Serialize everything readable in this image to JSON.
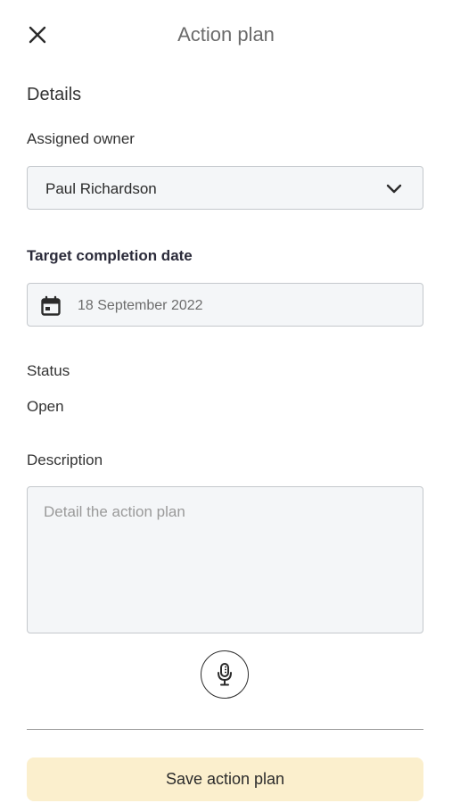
{
  "header": {
    "title": "Action plan",
    "close_icon": "close-icon"
  },
  "details": {
    "heading": "Details"
  },
  "owner": {
    "label": "Assigned owner",
    "value": "Paul Richardson",
    "icon": "chevron-down-icon"
  },
  "target_date": {
    "label": "Target completion date",
    "value": "18 September 2022",
    "icon": "calendar-icon"
  },
  "status": {
    "label": "Status",
    "value": "Open"
  },
  "description": {
    "label": "Description",
    "placeholder": "Detail the action plan",
    "value": ""
  },
  "mic": {
    "icon": "microphone-icon"
  },
  "save": {
    "label": "Save action plan",
    "background": "#fbefcd"
  },
  "colors": {
    "field_background": "#f4f6f8",
    "field_border": "#c4c8cc"
  }
}
